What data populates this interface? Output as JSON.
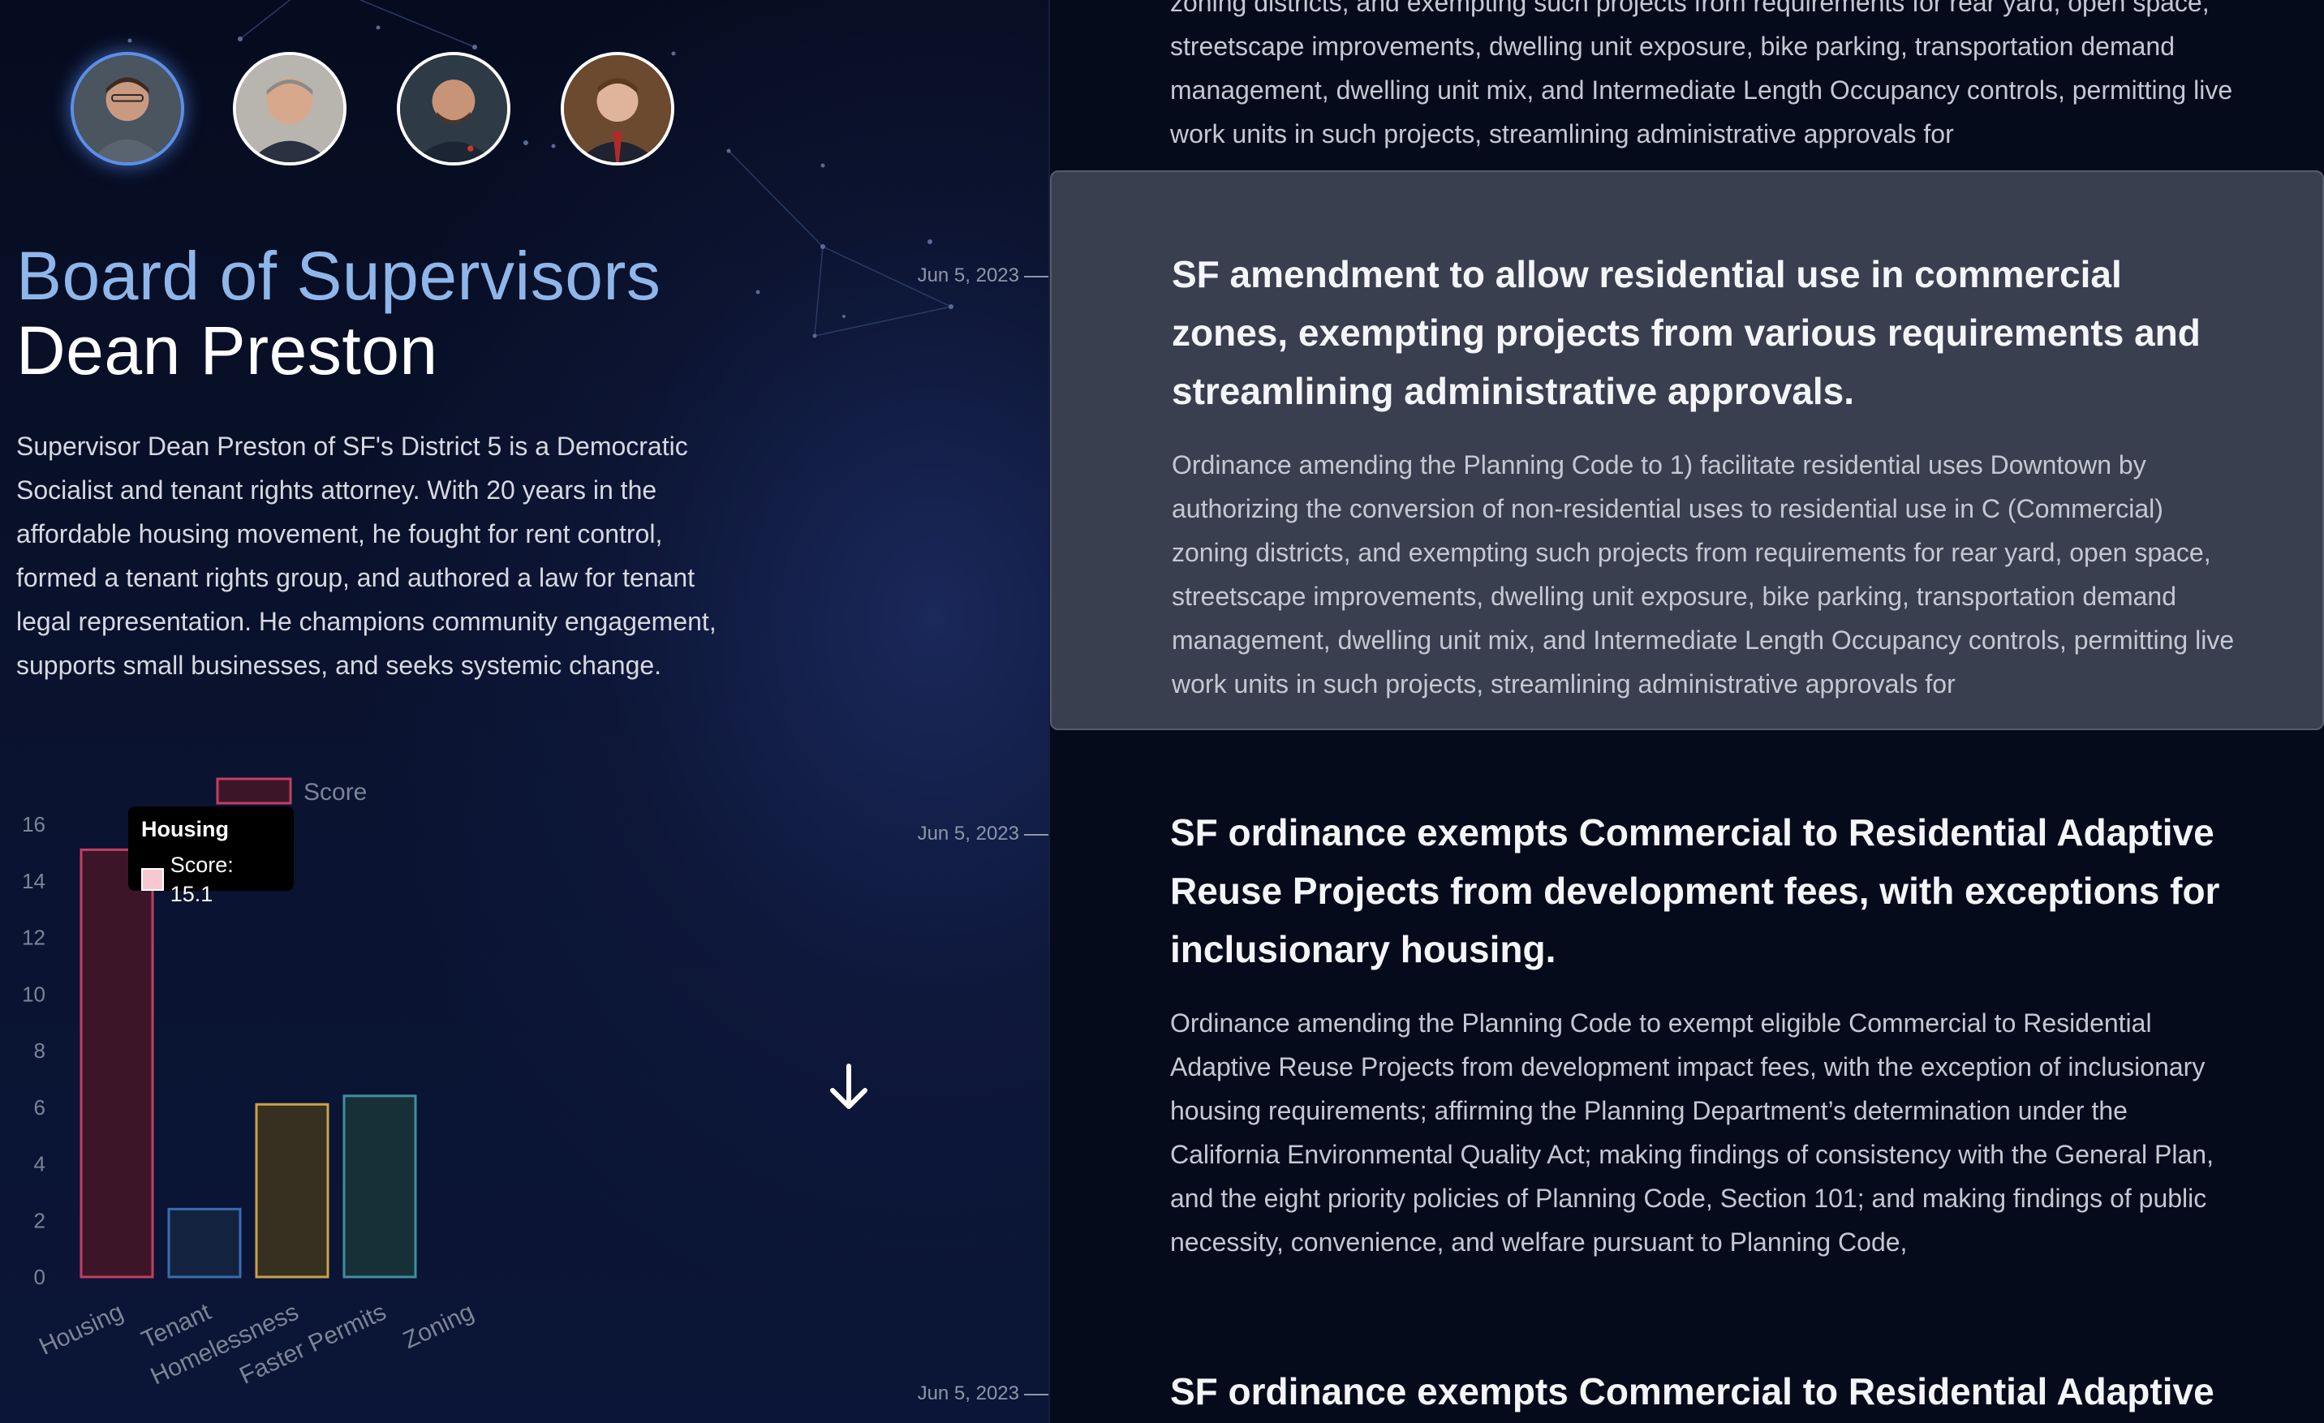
{
  "supervisors": [
    {
      "name": "avatar-1",
      "active": true
    },
    {
      "name": "avatar-2",
      "active": false
    },
    {
      "name": "avatar-3",
      "active": false
    },
    {
      "name": "avatar-4",
      "active": false
    }
  ],
  "header": {
    "org": "Board of Supervisors",
    "person": "Dean Preston"
  },
  "bio": "Supervisor Dean Preston of SF's District 5 is a Democratic Socialist and tenant rights attorney. With 20 years in the affordable housing movement, he fought for rent control, formed a tenant rights group, and authored a law for tenant legal representation. He champions community engagement, supports small businesses, and seeks systemic change.",
  "timeline": {
    "dates": [
      "Jun 5, 2023",
      "Jun 5, 2023",
      "Jun 5, 2023"
    ],
    "scroll_icon": "arrow-down-icon"
  },
  "legislation": [
    {
      "title": "",
      "body": "zoning districts, and exempting such projects from requirements for rear yard, open space, streetscape improvements, dwelling unit exposure, bike parking, transportation demand management, dwelling unit mix, and Intermediate Length Occupancy controls, permitting live work units in such projects, streamlining administrative approvals for"
    },
    {
      "title": "SF amendment to allow residential use in commercial zones, exempting projects from various requirements and streamlining administrative approvals.",
      "body": "Ordinance amending the Planning Code to 1) facilitate residential uses Downtown by authorizing the conversion of non-residential uses to residential use in C (Commercial) zoning districts, and exempting such projects from requirements for rear yard, open space, streetscape improvements, dwelling unit exposure, bike parking, transportation demand management, dwelling unit mix, and Intermediate Length Occupancy controls, permitting live work units in such projects, streamlining administrative approvals for"
    },
    {
      "title": "SF ordinance exempts Commercial to Residential Adaptive Reuse Projects from development fees, with exceptions for inclusionary housing.",
      "body": "Ordinance amending the Planning Code to exempt eligible Commercial to Residential Adaptive Reuse Projects from development impact fees, with the exception of inclusionary housing requirements; affirming the Planning Department’s determination under the California Environmental Quality Act; making findings of consistency with the General Plan, and the eight priority policies of Planning Code, Section 101; and making findings of public necessity, convenience, and welfare pursuant to Planning Code,"
    },
    {
      "title": "SF ordinance exempts Commercial to Residential Adaptive",
      "body": ""
    }
  ],
  "tooltip": {
    "title": "Housing",
    "label": "Score: 15.1"
  },
  "chart_data": {
    "type": "bar",
    "categories": [
      "Housing",
      "Tenant",
      "Homelessness",
      "Faster Permits",
      "Zoning"
    ],
    "series": [
      {
        "name": "Score",
        "values": [
          15.1,
          2.4,
          6.1,
          6.4,
          0
        ]
      }
    ],
    "ylim": [
      0,
      16
    ],
    "yticks": [
      0,
      2,
      4,
      6,
      8,
      10,
      12,
      14,
      16
    ],
    "legend": "top",
    "colors": {
      "fill": [
        "#3d1528",
        "#13233f",
        "#35301f",
        "#173038",
        "#2a2a2a"
      ],
      "stroke": [
        "#c2405f",
        "#3a6cae",
        "#c8a24a",
        "#3f8f9c",
        "#777777"
      ]
    },
    "grid": false
  }
}
